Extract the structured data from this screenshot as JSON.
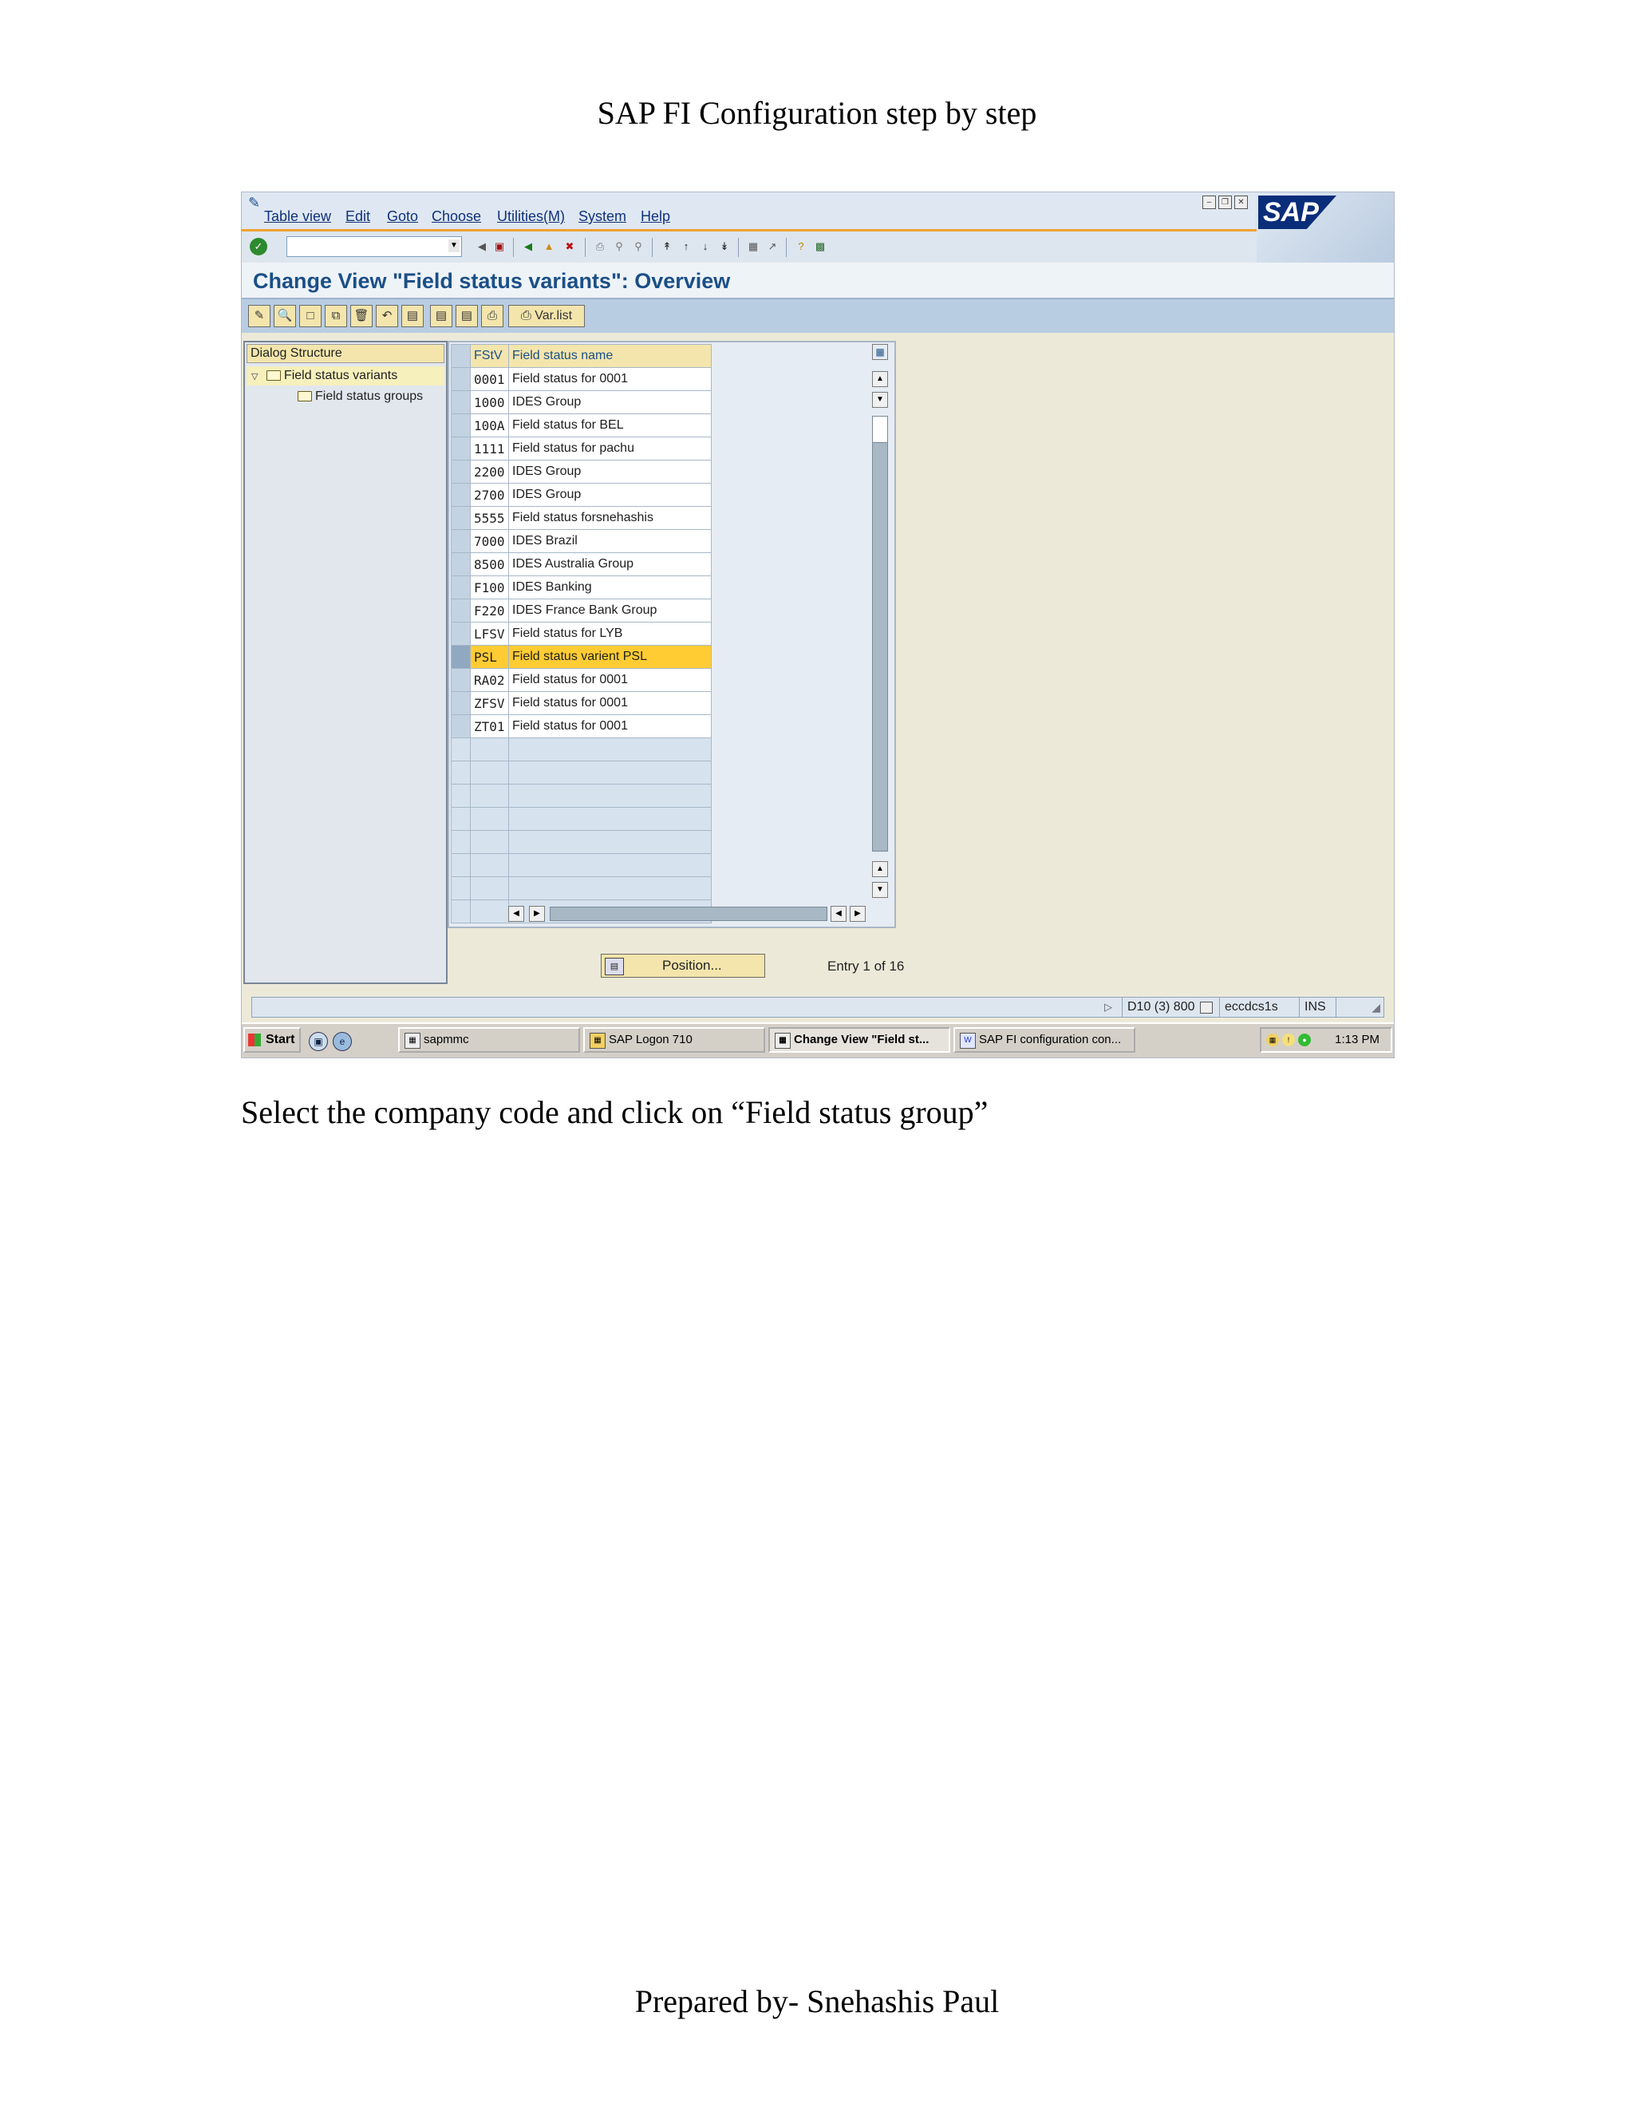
{
  "document": {
    "header": "SAP FI Configuration step by step",
    "instruction": "Select the company code and click on “Field status group”",
    "footer": "Prepared by- Snehashis Paul"
  },
  "menu": [
    "Table view",
    "Edit",
    "Goto",
    "Choose",
    "Utilities(M)",
    "System",
    "Help"
  ],
  "brand": {
    "logo_text": "SAP",
    "logo_color": "#0a2d7a"
  },
  "screen_title": "Change View \"Field status variants\": Overview",
  "app_toolbar": {
    "varlist_label": "Var.list"
  },
  "dialog_structure": {
    "header": "Dialog Structure",
    "items": [
      "Field status variants",
      "Field status groups"
    ]
  },
  "table": {
    "columns": [
      "FStV",
      "Field status name"
    ],
    "rows": [
      {
        "code": "0001",
        "name": "Field status for 0001"
      },
      {
        "code": "1000",
        "name": "IDES Group"
      },
      {
        "code": "100A",
        "name": "Field status for BEL"
      },
      {
        "code": "1111",
        "name": "Field status for pachu"
      },
      {
        "code": "2200",
        "name": "IDES Group"
      },
      {
        "code": "2700",
        "name": "IDES Group"
      },
      {
        "code": "5555",
        "name": "Field status forsnehashis"
      },
      {
        "code": "7000",
        "name": "IDES Brazil"
      },
      {
        "code": "8500",
        "name": "IDES Australia Group"
      },
      {
        "code": "F100",
        "name": "IDES Banking"
      },
      {
        "code": "F220",
        "name": "IDES France Bank Group"
      },
      {
        "code": "LFSV",
        "name": "Field status for LYB"
      },
      {
        "code": "PSL",
        "name": "Field status varient PSL"
      },
      {
        "code": "RA02",
        "name": "Field status for 0001"
      },
      {
        "code": "ZFSV",
        "name": "Field status for 0001"
      },
      {
        "code": "ZT01",
        "name": "Field status for 0001"
      }
    ],
    "selected_code": "PSL",
    "selected_color": "#ffcc33"
  },
  "position_button": "Position...",
  "entry_info": "Entry 1 of 16",
  "status": {
    "system": "D10 (3) 800",
    "server": "eccdcs1s",
    "mode": "INS"
  },
  "taskbar": {
    "start": "Start",
    "items": [
      "sapmmc",
      "SAP Logon 710",
      "Change View \"Field st...",
      "SAP FI configuration con..."
    ],
    "clock": "1:13 PM"
  }
}
